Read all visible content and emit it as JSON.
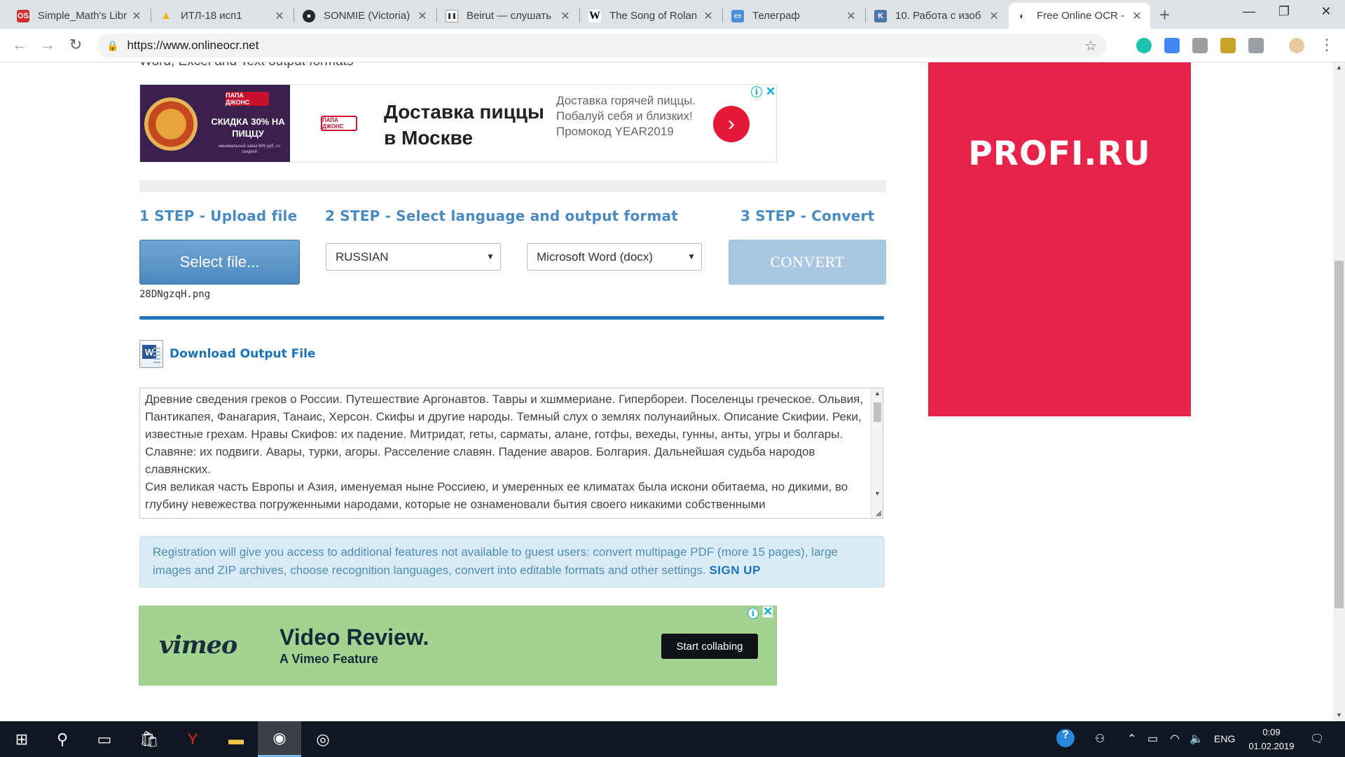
{
  "browser": {
    "tabs": [
      {
        "title": "Simple_Math's Libr",
        "favicon": "os-icon",
        "color": "#d32f2f",
        "glyph": "OS"
      },
      {
        "title": "ИТЛ-18 исп1",
        "favicon": "google-drive-icon",
        "color": "#f4b400",
        "glyph": "▲"
      },
      {
        "title": "SONMIE (Victoria)",
        "favicon": "github-icon",
        "color": "#24292e",
        "glyph": "●"
      },
      {
        "title": "Beirut — слушать",
        "favicon": "pause-icon",
        "color": "#444444",
        "glyph": "❚❚"
      },
      {
        "title": "The Song of Rolan",
        "favicon": "wikipedia-icon",
        "color": "#ffffff",
        "glyph": "W"
      },
      {
        "title": "Телеграф",
        "favicon": "telegraph-icon",
        "color": "#4a90d9",
        "glyph": "▭"
      },
      {
        "title": "10. Работа с изоб",
        "favicon": "vk-icon",
        "color": "#4a76a8",
        "glyph": "K"
      },
      {
        "title": "Free Online OCR -",
        "favicon": "onlineocr-icon",
        "color": "#1a3d6e",
        "glyph": "◐",
        "active": true
      }
    ],
    "url": "https://www.onlineocr.net"
  },
  "page": {
    "cut_text": "Word, Excel and Text output formats",
    "ad_top": {
      "brand": "ПАПА ДЖОНС",
      "promo": "СКИДКА 30% НА ПИЦЦУ",
      "promo_small": "минимальный заказ 699 руб. со скидкой",
      "headline": "Доставка пиццы в Москве",
      "description": "Доставка горячей пиццы. Побалуй себя и близких! Промокод YEAR2019"
    },
    "steps": {
      "step1": "1 STEP - Upload file",
      "step2": "2 STEP - Select language and output format",
      "step3": "3 STEP - Convert"
    },
    "select_file_label": "Select file...",
    "filename": "28DNgzqH.png",
    "language": "RUSSIAN",
    "output_format": "Microsoft Word (docx)",
    "convert_label": "CONVERT",
    "progress": 1.0,
    "download_label": "Download Output File",
    "ocr_text": "Древние сведения греков о России. Путешествие Аргонавтов. Тавры и хшммериане. Гипербореи. Поселенцы греческое. Ольвия, Пантикапея, Фанагария, Танаис, Херсон. Скифы и другие народы. Темный слух о землях полунаийных. Описание Скифии. Реки, известные грехам. Нравы Скифов: их падение. Митридат, геты, сарматы, алане, готфы, вехеды, гунны, анты, угры и болгары. Славяне: их подвиги. Авары, турки, агоры. Расселение славян. Падение аваров. Болгария. Дальнейшая судьба народов славянских.\nСия великая часть Европы и Азия, именуемая ныне Россиею, и умеренных ее климатах была искони обитаема, но дикими, во глубину невежества погруженными народами, которые не ознаменовали бытия своего никакими собственными",
    "registration": {
      "text": "Registration will give you access to additional features not available to guest users: convert multipage PDF (more 15 pages), large images and ZIP archives, choose recognition languages, convert into editable formats and other settings.",
      "signup": "SIGN UP"
    },
    "ad_bottom": {
      "brand": "vimeo",
      "title": "Video Review.",
      "subtitle": "A Vimeo Feature",
      "cta": "Start collabing"
    },
    "sidebar_ad": {
      "brand": "PROFI.RU",
      "color": "#e8234a"
    }
  },
  "taskbar": {
    "language": "ENG",
    "time": "0:09",
    "date": "01.02.2019"
  }
}
